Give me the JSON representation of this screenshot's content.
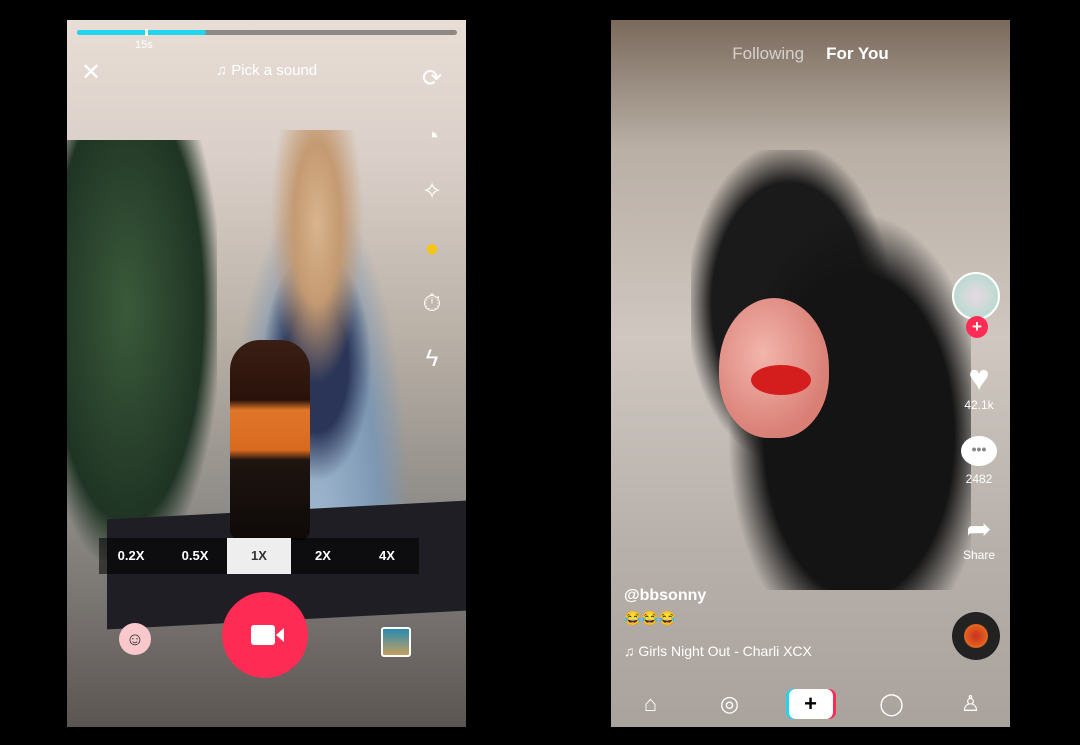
{
  "recorder": {
    "progress_percent": 34,
    "progress_mark_label": "15s",
    "sound_label": "Pick a sound",
    "speeds": [
      "0.2X",
      "0.5X",
      "1X",
      "2X",
      "4X"
    ],
    "selected_speed": "1X",
    "accent": "#20d5ec",
    "record_color": "#fe2c55",
    "right_icons": [
      "flip-camera-icon",
      "speed-timer-icon",
      "beauty-wand-icon",
      "filters-icon",
      "countdown-timer-icon",
      "flash-off-icon"
    ]
  },
  "feed": {
    "tabs": {
      "following": "Following",
      "for_you": "For You"
    },
    "likes": "42.1k",
    "comments": "2482",
    "share": "Share",
    "username": "@bbsonny",
    "caption": "😂😂😂",
    "song": "Girls Night Out - Charli XCX",
    "nav_icons": [
      "home-icon",
      "discover-icon",
      "create-icon",
      "inbox-icon",
      "profile-icon"
    ],
    "follow_plus": "+",
    "create_plus": "+"
  }
}
